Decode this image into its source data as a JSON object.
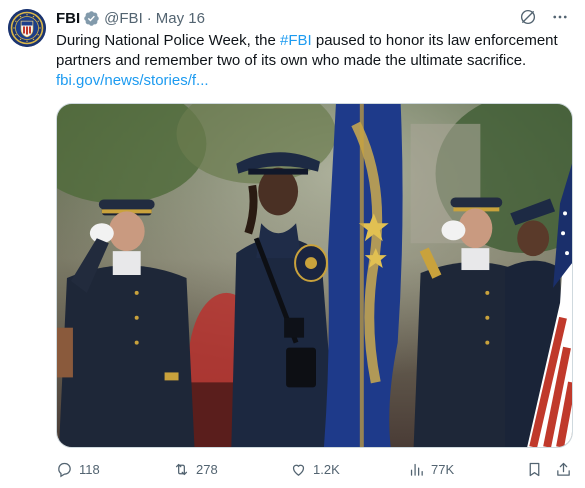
{
  "account": {
    "display_name": "FBI",
    "handle": "@FBI",
    "separator": "·",
    "date": "May 16",
    "verified": true,
    "avatar_icon": "fbi-seal-icon"
  },
  "tweet": {
    "text_before": "During National Police Week, the ",
    "hashtag": "#FBI",
    "text_after": " paused to honor its law enforcement partners and remember two of its own who made the ultimate sacrifice.",
    "link": "fbi.gov/news/stories/f..."
  },
  "top_actions": {
    "grok_icon": "grok-icon",
    "more_icon": "more-icon"
  },
  "metrics": {
    "replies": "118",
    "retweets": "278",
    "likes": "1.2K",
    "views": "77K"
  },
  "colors": {
    "accent": "#1d9bf0",
    "text": "#0f1419",
    "muted": "#536471",
    "verified_badge": "#829aab"
  }
}
